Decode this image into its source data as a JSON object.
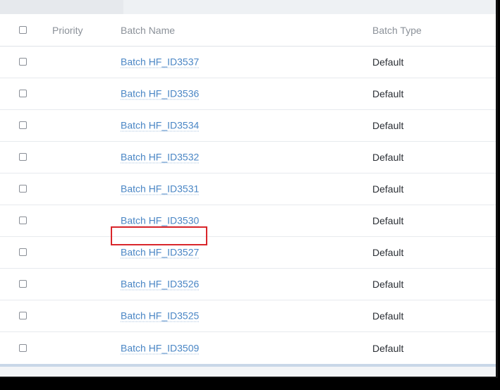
{
  "table": {
    "headers": {
      "priority": "Priority",
      "batch_name": "Batch Name",
      "batch_type": "Batch Type"
    },
    "rows": [
      {
        "name": "Batch HF_ID3537",
        "type": "Default"
      },
      {
        "name": "Batch HF_ID3536",
        "type": "Default"
      },
      {
        "name": "Batch HF_ID3534",
        "type": "Default"
      },
      {
        "name": "Batch HF_ID3532",
        "type": "Default"
      },
      {
        "name": "Batch HF_ID3531",
        "type": "Default"
      },
      {
        "name": "Batch HF_ID3530",
        "type": "Default"
      },
      {
        "name": "Batch HF_ID3527",
        "type": "Default"
      },
      {
        "name": "Batch HF_ID3526",
        "type": "Default"
      },
      {
        "name": "Batch HF_ID3525",
        "type": "Default"
      },
      {
        "name": "Batch HF_ID3509",
        "type": "Default"
      }
    ]
  },
  "colors": {
    "link": "#4a86c5",
    "highlight": "#d9262b",
    "header_text": "#8b9199",
    "body_text": "#2b2f35"
  }
}
